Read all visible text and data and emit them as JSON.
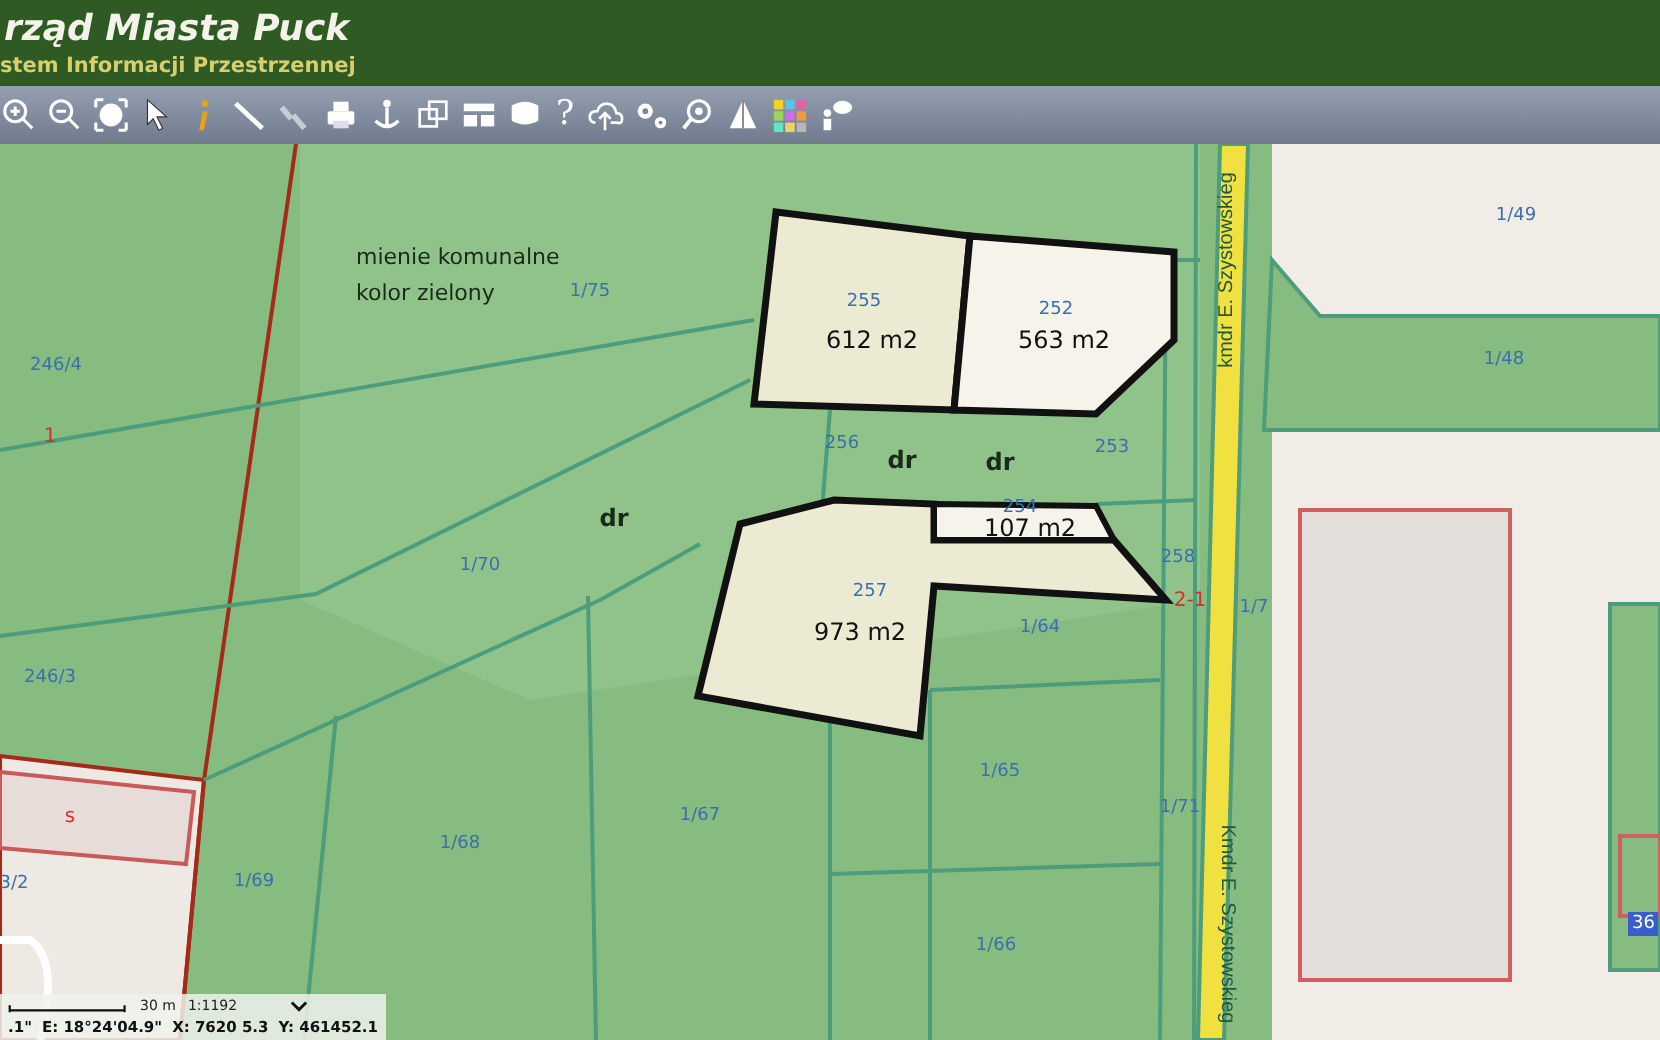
{
  "header": {
    "title": "rząd Miasta Puck",
    "subtitle": "stem Informacji Przestrzennej"
  },
  "toolbar": {
    "help_label": "?"
  },
  "map": {
    "parcel_numbers": [
      "246/4",
      "246/3",
      "1/75",
      "1/70",
      "1/68",
      "1/69",
      "3/2",
      "255",
      "252",
      "256",
      "253",
      "254",
      "258",
      "257",
      "1/64",
      "1/65",
      "1/67",
      "1/71",
      "1/66",
      "1/49",
      "1/48",
      "1/7"
    ],
    "badge_label": "36",
    "area_labels": [
      "612 m2",
      "563 m2",
      "107 m2",
      "973 m2"
    ],
    "land_use_labels": [
      "dr",
      "dr",
      "dr"
    ],
    "note": [
      "mienie komunalne",
      "kolor zielony"
    ],
    "red_labels": [
      "1",
      "s",
      "2-1"
    ],
    "street_labels": [
      "kmdr E. Szystowskieg",
      "Kmdr E. Szystowskieg"
    ]
  },
  "status_bar": {
    "scale_label": "30 m",
    "scale_ratio": "1:1192",
    "coordinates": [
      ".1\"",
      "E: 18°24'04.9\"",
      "X: 7620 5.3",
      "Y: 461452.1"
    ]
  }
}
